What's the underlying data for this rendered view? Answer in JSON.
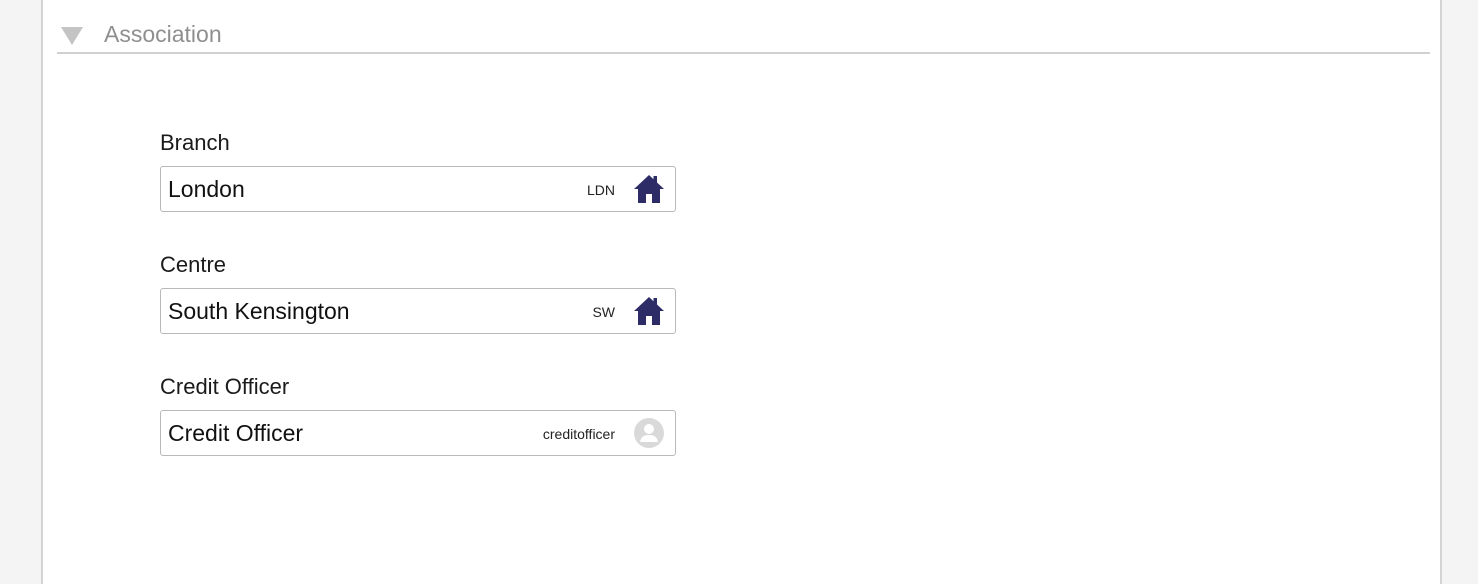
{
  "section": {
    "title": "Association",
    "collapse_icon": "triangle-down-icon"
  },
  "fields": {
    "branch": {
      "label": "Branch",
      "value": "London",
      "code": "LDN",
      "icon": "home-icon"
    },
    "centre": {
      "label": "Centre",
      "value": "South Kensington",
      "code": "SW",
      "icon": "home-icon"
    },
    "credit_officer": {
      "label": "Credit Officer",
      "value": "Credit Officer",
      "code": "creditofficer",
      "icon": "user-avatar-icon"
    }
  },
  "colors": {
    "home_icon": "#2e2c66",
    "avatar_icon": "#d9d9d9",
    "section_title": "#8f8f8f"
  }
}
